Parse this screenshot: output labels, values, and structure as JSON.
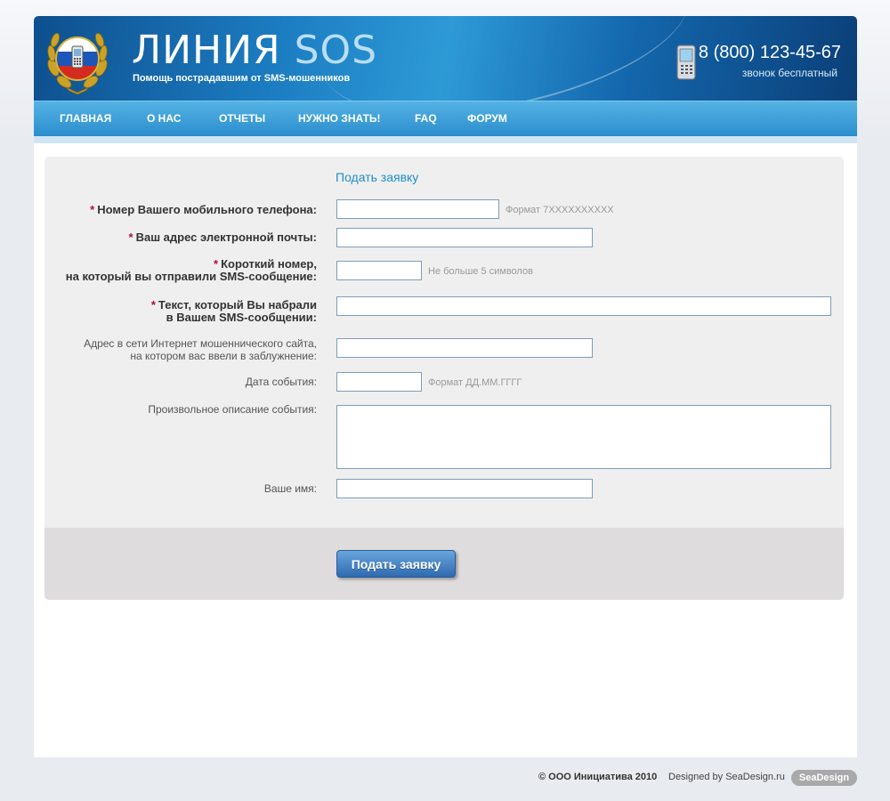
{
  "header": {
    "title_main": "ЛИНИЯ",
    "title_accent": "SOS",
    "subtitle": "Помощь пострадавшим от SMS-мошенников",
    "phone_number": "8 (800) 123-45-67",
    "phone_note": "звонок бесплатный"
  },
  "nav": {
    "items": [
      {
        "label": "ГЛАВНАЯ"
      },
      {
        "label": "О НАС"
      },
      {
        "label": "ОТЧЕТЫ"
      },
      {
        "label": "НУЖНО ЗНАТЬ!"
      },
      {
        "label": "FAQ"
      },
      {
        "label": "ФОРУМ"
      }
    ]
  },
  "form": {
    "title": "Подать заявку",
    "required_mark": "*",
    "fields": {
      "phone": {
        "label": "Номер Вашего мобильного телефона:",
        "value": "",
        "hint": "Формат 7XXXXXXXXXX"
      },
      "email": {
        "label": "Ваш адрес электронной почты:",
        "value": ""
      },
      "short_number": {
        "label_line1": "Короткий номер,",
        "label_line2": "на который вы отправили SMS-сообщение:",
        "value": "",
        "hint": "Не больше 5 символов"
      },
      "sms_text": {
        "label_line1": "Текст, который Вы набрали",
        "label_line2": "в Вашем SMS-сообщении:",
        "value": ""
      },
      "website": {
        "label_line1": "Адрес в сети Интернет мошеннического сайта,",
        "label_line2": "на котором вас ввели в заблужнение:",
        "value": ""
      },
      "date": {
        "label": "Дата события:",
        "value": "",
        "hint": "Формат ДД.ММ.ГГГГ"
      },
      "description": {
        "label": "Произвольное описание события:",
        "value": ""
      },
      "name": {
        "label": "Ваше имя:",
        "value": ""
      }
    },
    "submit_label": "Подать заявку"
  },
  "footer": {
    "copyright": "© ООО Инициатива 2010",
    "designed_by": "Designed by SeaDesign.ru",
    "badge": "SeaDesign"
  },
  "colors": {
    "header_dark": "#0e4f8e",
    "nav_blue": "#2b8dcd",
    "accent_title": "#1f8fc9",
    "required_star": "#b0103a",
    "button_blue": "#2f6aaf"
  }
}
